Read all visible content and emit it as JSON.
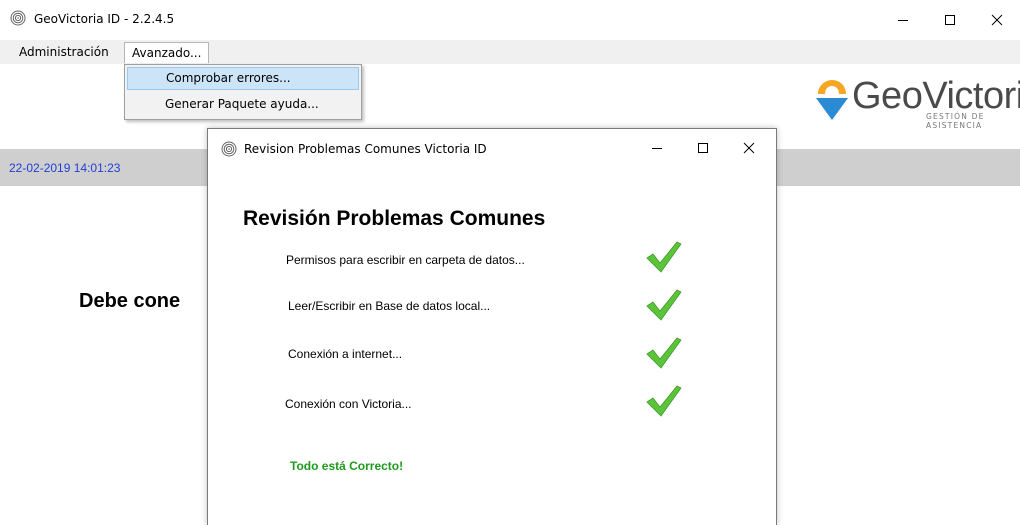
{
  "window": {
    "title": "GeoVictoria ID - 2.2.4.5",
    "icon": "fingerprint-icon"
  },
  "menubar": {
    "items": [
      {
        "label": "Administración"
      },
      {
        "label": "Avanzado..."
      }
    ],
    "dropdown": [
      {
        "label": "Comprobar errores..."
      },
      {
        "label": "Generar Paquete ayuda..."
      }
    ]
  },
  "logo": {
    "text": "GeoVictoria",
    "subtitle": "GESTIÓN DE ASISTENCIA"
  },
  "status": {
    "timestamp": "22-02-2019 14:01:23"
  },
  "main": {
    "message": "Debe cone"
  },
  "dialog": {
    "title": "Revision Problemas Comunes Victoria ID",
    "heading": "Revisión Problemas Comunes",
    "checks": [
      {
        "label": "Permisos para escribir en carpeta de datos...",
        "status": "ok"
      },
      {
        "label": "Leer/Escribir en Base de datos local...",
        "status": "ok"
      },
      {
        "label": "Conexión a internet...",
        "status": "ok"
      },
      {
        "label": "Conexión con Victoria...",
        "status": "ok"
      }
    ],
    "result": "Todo está Correcto!"
  },
  "colors": {
    "timestamp": "#1f3fd6",
    "success": "#1e9a1e",
    "highlight": "#cce4f7",
    "logo_orange": "#f5a623",
    "logo_blue": "#2a8ad4"
  }
}
